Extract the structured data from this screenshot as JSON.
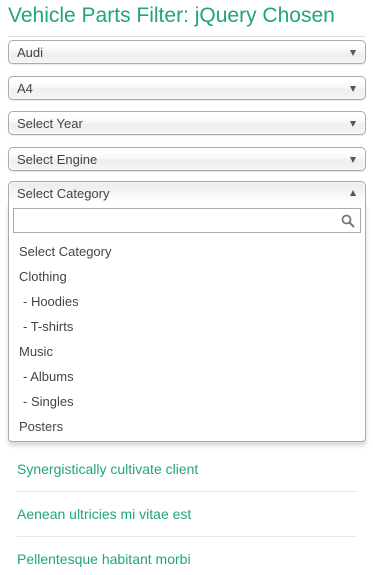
{
  "page": {
    "title": "Vehicle Parts Filter: jQuery Chosen"
  },
  "colors": {
    "accent": "#1fa67a",
    "text": "#444444",
    "border": "#aaaaaa"
  },
  "selects": {
    "make": {
      "value": "Audi",
      "icon": "chevron-down-icon"
    },
    "model": {
      "value": "A4",
      "icon": "chevron-down-icon"
    },
    "year": {
      "value": "Select Year",
      "icon": "chevron-down-icon"
    },
    "engine": {
      "value": "Select Engine",
      "icon": "chevron-down-icon"
    },
    "category": {
      "value": "Select Category",
      "icon": "chevron-up-icon",
      "open": true,
      "search": {
        "value": "",
        "placeholder": "",
        "icon": "search-icon"
      },
      "options": [
        "Select Category",
        "Clothing",
        "- Hoodies",
        "- T-shirts",
        "Music",
        "- Albums",
        "- Singles",
        "Posters"
      ]
    }
  },
  "links": [
    "Synergistically cultivate client",
    "Aenean ultricies mi vitae est",
    "Pellentesque habitant morbi"
  ]
}
